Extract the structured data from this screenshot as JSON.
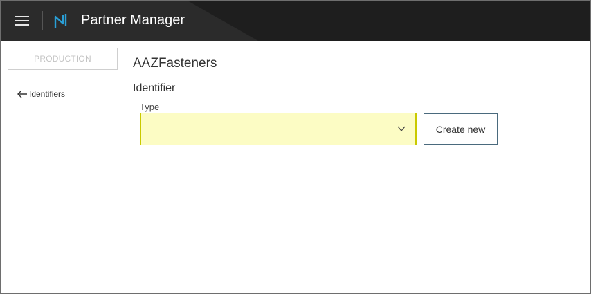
{
  "header": {
    "title": "Partner Manager",
    "menu_icon": "hamburger-menu-icon",
    "logo_icon": "partner-manager-logo-icon",
    "logo_color": "#2a9fd6"
  },
  "sidebar": {
    "environment": "PRODUCTION",
    "back_link": {
      "label": "Identifiers",
      "icon": "arrow-left-icon"
    }
  },
  "main": {
    "partner_name": "AAZFasteners",
    "section_title": "Identifier",
    "type_field": {
      "label": "Type",
      "value": "",
      "icon": "chevron-down-icon",
      "highlight_color": "#fcfcc4"
    },
    "create_button": "Create new"
  }
}
